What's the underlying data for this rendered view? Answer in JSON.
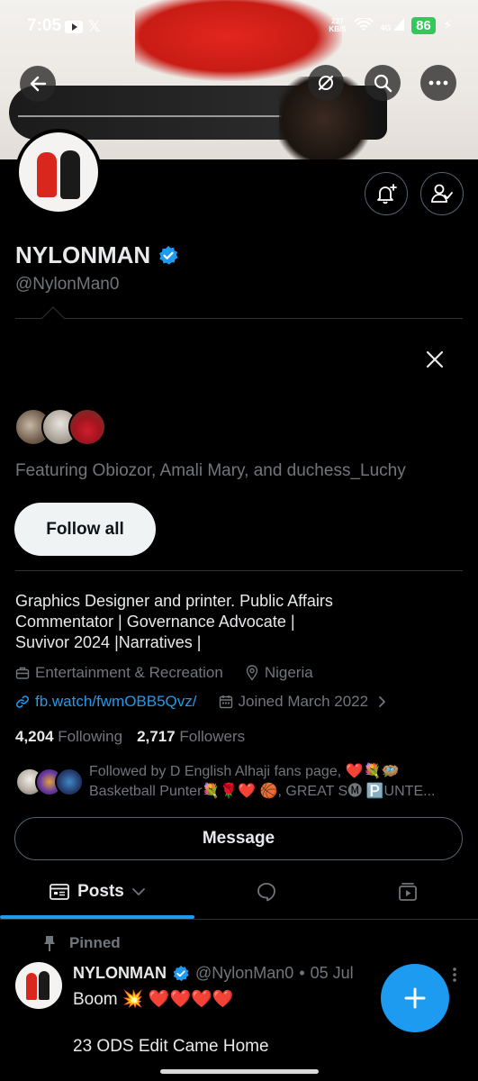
{
  "status_bar": {
    "time": "7:05",
    "speed_value": "227",
    "speed_unit": "KB/S",
    "network": "4G",
    "battery": "86"
  },
  "profile": {
    "name": "NYLONMAN",
    "handle": "@NylonMan0",
    "verified": true,
    "bio_line1": "Graphics Designer and printer. Public Affairs",
    "bio_line2": "Commentator | Governance Advocate |",
    "bio_line3": "Suvivor 2024  |Narratives |",
    "category": "Entertainment & Recreation",
    "location": "Nigeria",
    "link": "fb.watch/fwmOBB5Qvz/",
    "joined": "Joined March 2022",
    "following_count": "4,204",
    "following_label": "Following",
    "followers_count": "2,717",
    "followers_label": "Followers",
    "followed_by_line1": "Followed by D English Alhaji fans page, ❤️💐🪺",
    "followed_by_line2": "Basketball Punter💐🌹❤️ 🏀, GREAT S🅜 🅿️UNTE..."
  },
  "suggestions": {
    "featuring_text": "Featuring Obiozor, Amali Mary, and duchess_Luchy",
    "follow_all_label": "Follow all"
  },
  "actions": {
    "message_label": "Message"
  },
  "tabs": {
    "posts_label": "Posts"
  },
  "pinned_post": {
    "pinned_label": "Pinned",
    "author_name": "NYLONMAN",
    "author_handle": "@NylonMan0",
    "separator": "•",
    "date": "05 Jul",
    "text_line1": "Boom 💥 ❤️❤️❤️❤️",
    "text_line2": "23 ODS Edit Came Home"
  },
  "colors": {
    "accent": "#1d9bf0",
    "background": "#000000",
    "secondary_text": "#71767b"
  }
}
